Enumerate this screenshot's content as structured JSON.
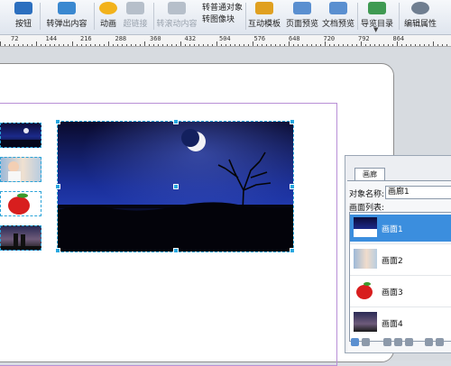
{
  "toolbar": {
    "buttons": [
      {
        "label": "按钮",
        "icon": "button-icon",
        "color": "#2c6fbf",
        "disabled": false
      },
      {
        "label": "转弹出内容",
        "icon": "popup-content-icon",
        "color": "#3a88d0",
        "disabled": false
      },
      {
        "label": "动画",
        "icon": "star-icon",
        "color": "#f2b21b",
        "disabled": false
      },
      {
        "label": "超链接",
        "icon": "hyperlink-icon",
        "color": "#b6bfca",
        "disabled": true
      },
      {
        "label": "转滚动内容",
        "icon": "scroll-content-icon",
        "color": "#b6bfca",
        "disabled": true
      },
      {
        "label": "互动模板",
        "icon": "template-icon",
        "color": "#e0a020",
        "disabled": false
      },
      {
        "label": "页面预览",
        "icon": "page-preview-icon",
        "color": "#5a8fd0",
        "disabled": false
      },
      {
        "label": "文档预览",
        "icon": "document-preview-icon",
        "color": "#5a8fd0",
        "disabled": false
      },
      {
        "label": "导览目录",
        "icon": "navigation-catalog-icon",
        "color": "#3f9a52",
        "disabled": false
      },
      {
        "label": "编辑属性",
        "icon": "gear-icon",
        "color": "#6f7e90",
        "disabled": false
      }
    ],
    "convert_normal_label": "转普通对象",
    "convert_gallery_label": "转图像块"
  },
  "ruler": {
    "numbers": [
      "72",
      "144",
      "216",
      "288",
      "360",
      "432",
      "504",
      "576",
      "648",
      "720",
      "792",
      "864"
    ]
  },
  "panel": {
    "tab_label": "画廊",
    "object_name_label": "对象名称:",
    "object_name_value": "画廊1",
    "list_label": "画面列表:",
    "items": [
      {
        "label": "画面1",
        "selected": true
      },
      {
        "label": "画面2",
        "selected": false
      },
      {
        "label": "画面3",
        "selected": false
      },
      {
        "label": "画面4",
        "selected": false
      }
    ]
  },
  "colors": {
    "selection_blue": "#3b8ede",
    "handle_blue": "#29a8e0",
    "frame_purple": "#b98fd6",
    "apple_red": "#d81e1e"
  }
}
